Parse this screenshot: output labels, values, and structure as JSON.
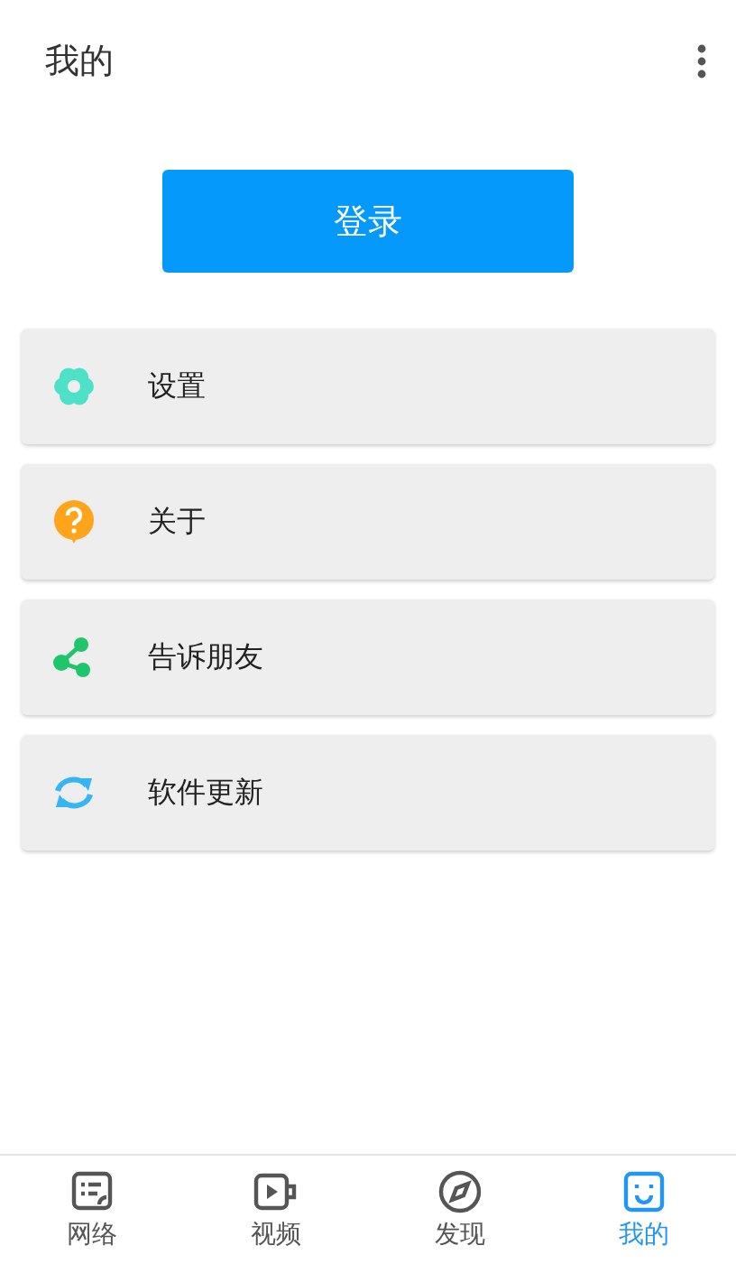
{
  "header": {
    "title": "我的"
  },
  "login_button": {
    "label": "登录"
  },
  "menu": [
    {
      "kind": "settings",
      "label": "设置"
    },
    {
      "kind": "about",
      "label": "关于"
    },
    {
      "kind": "share",
      "label": "告诉朋友"
    },
    {
      "kind": "update",
      "label": "软件更新"
    }
  ],
  "tabs": [
    {
      "kind": "network",
      "label": "网络",
      "selected": false
    },
    {
      "kind": "video",
      "label": "视频",
      "selected": false
    },
    {
      "kind": "discover",
      "label": "发现",
      "selected": false
    },
    {
      "kind": "me",
      "label": "我的",
      "selected": true
    }
  ]
}
